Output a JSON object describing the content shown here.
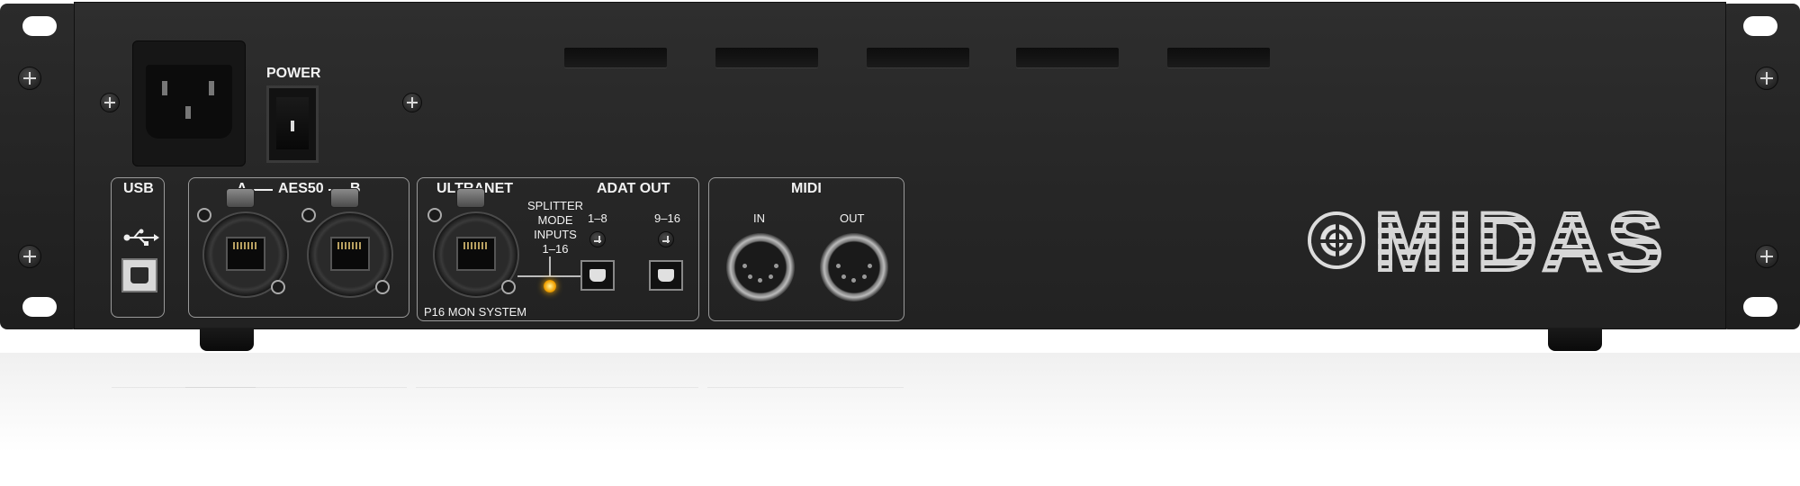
{
  "labels": {
    "power": "POWER",
    "usb": "USB",
    "aes50_a": "A",
    "aes50": "AES50",
    "aes50_b": "B",
    "ultranet": "ULTRANET",
    "adat_out": "ADAT OUT",
    "adat_1_8": "1–8",
    "adat_9_16": "9–16",
    "splitter_line1": "SPLITTER",
    "splitter_line2": "MODE",
    "splitter_line3": "INPUTS",
    "splitter_line4": "1–16",
    "p16": "P16 MON SYSTEM",
    "midi": "MIDI",
    "midi_in": "IN",
    "midi_out": "OUT",
    "brand": "MIDAS"
  },
  "icons": {
    "usb": "usb-symbol-icon",
    "splitter": "splitter-symbol-icon",
    "logo": "midas-logo-icon"
  },
  "colors": {
    "chassis": "#2a2a2a",
    "label": "#f2f2f2",
    "panel_outline": "#9a9a9a",
    "led": "#f0a000"
  }
}
